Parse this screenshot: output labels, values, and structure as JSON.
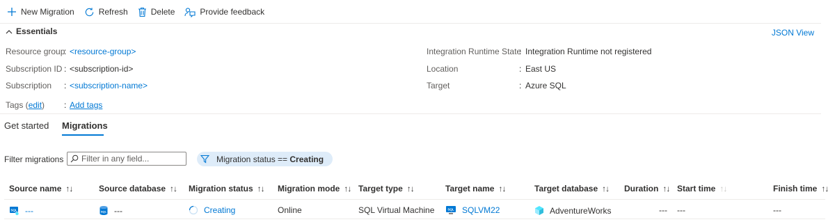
{
  "toolbar": {
    "new_migration": "New Migration",
    "refresh": "Refresh",
    "delete": "Delete",
    "feedback": "Provide feedback"
  },
  "essentials": {
    "title": "Essentials",
    "json_view": "JSON View",
    "left": {
      "resource_group_label": "Resource group",
      "resource_group_value": "<resource-group>",
      "subscription_id_label": "Subscription ID",
      "subscription_id_value": "<subscription-id>",
      "subscription_label": "Subscription",
      "subscription_value": "<subscription-name>",
      "tags_label_prefix": "Tags (",
      "tags_edit": "edit",
      "tags_label_suffix": ")",
      "tags_value": "Add tags"
    },
    "right": {
      "ir_state_label": "Integration Runtime State",
      "ir_state_value": "Integration Runtime not registered",
      "location_label": "Location",
      "location_value": "East US",
      "target_label": "Target",
      "target_value": "Azure SQL"
    },
    "colon": ":"
  },
  "tabs": {
    "get_started": "Get started",
    "migrations": "Migrations"
  },
  "filter": {
    "label": "Filter migrations",
    "placeholder": "Filter in any field...",
    "pill_prefix": "Migration status == ",
    "pill_value": "Creating"
  },
  "table": {
    "sort_glyph": "↑↓",
    "headers": {
      "source_name": "Source name",
      "source_database": "Source database",
      "migration_status": "Migration status",
      "migration_mode": "Migration mode",
      "target_type": "Target type",
      "target_name": "Target name",
      "target_database": "Target database",
      "duration": "Duration",
      "start_time": "Start time",
      "finish_time": "Finish time"
    },
    "row": {
      "source_name": "---",
      "source_database": "---",
      "migration_status": "Creating",
      "migration_mode": "Online",
      "target_type": "SQL Virtual Machine",
      "target_name": "SQLVM22",
      "target_database": "AdventureWorks",
      "duration": "---",
      "start_time": "---",
      "finish_time": "---"
    }
  },
  "colors": {
    "accent": "#0078d4",
    "pill_bg": "#deecf9",
    "separator": "#edebe9"
  }
}
